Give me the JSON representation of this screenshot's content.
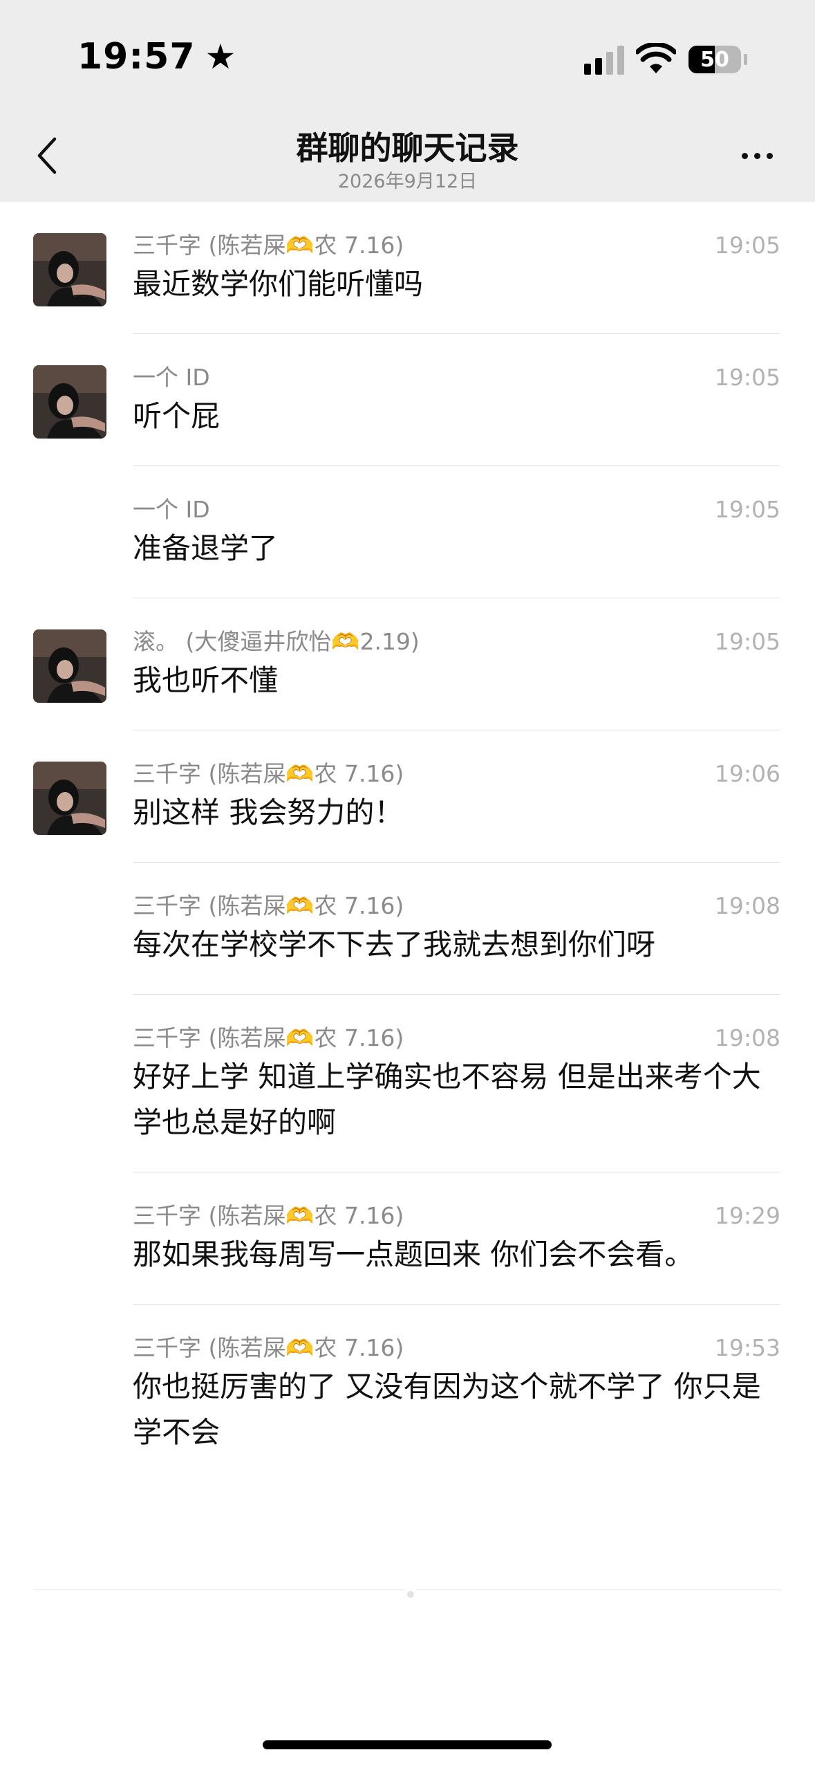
{
  "status_bar": {
    "time": "19:57",
    "battery": "50",
    "battery_level": 0.5
  },
  "nav": {
    "title": "群聊的聊天记录",
    "date": "2026年9月12日"
  },
  "messages": [
    {
      "sender": "三千字 (陈若屎🫶农 7.16)",
      "time": "19:05",
      "text": "最近数学你们能听懂吗",
      "avatar": true
    },
    {
      "sender": "一个 ID",
      "time": "19:05",
      "text": "听个屁",
      "avatar": true
    },
    {
      "sender": "一个 ID",
      "time": "19:05",
      "text": "准备退学了",
      "avatar": false
    },
    {
      "sender": "滚。 (大傻逼井欣怡🫶2.19)",
      "time": "19:05",
      "text": "我也听不懂",
      "avatar": true
    },
    {
      "sender": "三千字 (陈若屎🫶农 7.16)",
      "time": "19:06",
      "text": "别这样 我会努力的！",
      "avatar": true
    },
    {
      "sender": "三千字 (陈若屎🫶农 7.16)",
      "time": "19:08",
      "text": "每次在学校学不下去了我就去想到你们呀",
      "avatar": false
    },
    {
      "sender": "三千字 (陈若屎🫶农 7.16)",
      "time": "19:08",
      "text": "好好上学 知道上学确实也不容易 但是出来考个大学也总是好的啊",
      "avatar": false
    },
    {
      "sender": "三千字 (陈若屎🫶农 7.16)",
      "time": "19:29",
      "text": "那如果我每周写一点题回来 你们会不会看。",
      "avatar": false
    },
    {
      "sender": "三千字 (陈若屎🫶农 7.16)",
      "time": "19:53",
      "text": "你也挺厉害的了 又没有因为这个就不学了 你只是学不会",
      "avatar": false
    }
  ]
}
